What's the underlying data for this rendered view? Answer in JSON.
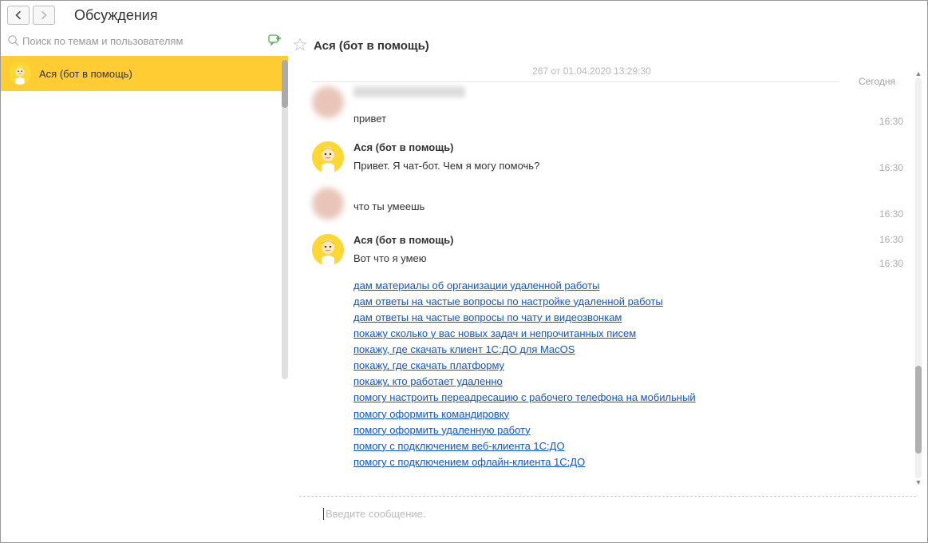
{
  "header": {
    "title": "Обсуждения"
  },
  "search": {
    "placeholder": "Поиск по темам и пользователям"
  },
  "sidebar": {
    "items": [
      {
        "label": "Ася (бот в помощь)",
        "active": true
      }
    ]
  },
  "chat": {
    "title": "Ася (бот в помощь)",
    "prev_date": "267 от 01.04.2020 13:29:30",
    "today_label": "Сегодня",
    "input_placeholder": "Введите сообщение.",
    "messages": [
      {
        "sender": "user",
        "name_hidden": true,
        "text": "привет",
        "time": "16:30"
      },
      {
        "sender": "bot",
        "name": "Ася (бот в помощь)",
        "text": "Привет. Я чат-бот. Чем я могу помочь?",
        "time": "16:30"
      },
      {
        "sender": "user",
        "name_hidden": true,
        "text": "что ты умеешь",
        "time": "16:30"
      },
      {
        "sender": "bot",
        "name": "Ася (бот в помощь)",
        "text": "Вот что я умею",
        "time": "16:30",
        "links_time": "16:30",
        "links": [
          "дам материалы об организации удаленной работы",
          "дам ответы на частые вопросы по настройке удаленной работы",
          "дам ответы на частые вопросы по чату и видеозвонкам",
          "покажу сколько у вас новых задач и непрочитанных писем",
          "покажу, где скачать клиент 1С:ДО для MacOS",
          "покажу, где скачать платформу",
          "покажу, кто работает удаленно",
          "помогу настроить переадресацию с рабочего телефона на мобильный",
          "помогу оформить командировку",
          "помогу оформить удаленную работу",
          "помогу с подключением веб-клиента 1С:ДО",
          "помогу с подключением офлайн-клиента 1С:ДО"
        ]
      }
    ]
  }
}
